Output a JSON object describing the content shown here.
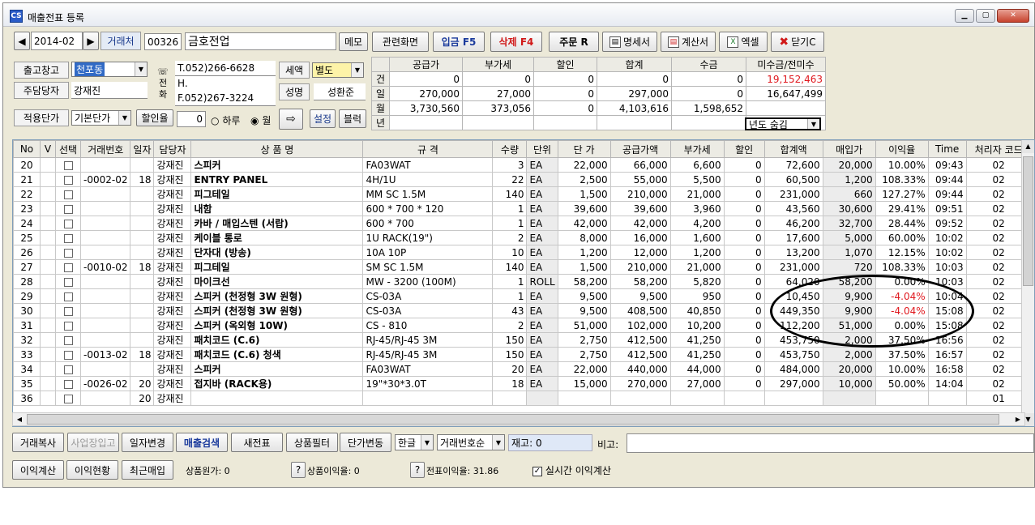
{
  "window": {
    "title": "매출전표 등록"
  },
  "header": {
    "period": "2014-02",
    "customer_label": "거래처",
    "customer_code": "00326",
    "customer_name": "금호전업",
    "memo_label": "메모",
    "warehouse_label": "출고창고",
    "warehouse_value": "천포동",
    "manager_label": "주담당자",
    "manager_value": "강재진",
    "price_label": "적용단가",
    "price_value": "기본단가",
    "discount_label": "할인율",
    "discount_value": "0",
    "radio_day": "하루",
    "radio_month": "월",
    "setting_label": "설정",
    "block_label": "블럭",
    "phone_label": "전화",
    "tel": "T.052)266-6628",
    "hp": "H.",
    "fax": "F.052)267-3224",
    "tax_label": "세액",
    "tax_value": "별도",
    "name_label": "성명",
    "name_value": "성환준"
  },
  "toolbar": {
    "related": "관련화면",
    "deposit": "입금 F5",
    "delete": "삭제 F4",
    "order": "주문 R",
    "statement": "명세서",
    "invoice": "계산서",
    "excel": "엑셀",
    "close": "닫기C"
  },
  "summary": {
    "headers": [
      "공급가",
      "부가세",
      "할인",
      "합계",
      "수금",
      "미수금/전미수"
    ],
    "rows": [
      {
        "label": "건",
        "values": [
          "0",
          "0",
          "0",
          "0",
          "0",
          "19,152,463"
        ]
      },
      {
        "label": "일",
        "values": [
          "270,000",
          "27,000",
          "0",
          "297,000",
          "0",
          "16,647,499"
        ]
      },
      {
        "label": "월",
        "values": [
          "3,730,560",
          "373,056",
          "0",
          "4,103,616",
          "1,598,652",
          ""
        ]
      },
      {
        "label": "년",
        "values": [
          "",
          "",
          "",
          "",
          "",
          ""
        ]
      }
    ],
    "year_select": "년도 숨김"
  },
  "grid": {
    "columns": [
      "No",
      "V",
      "선택",
      "거래번호",
      "일자",
      "담당자",
      "상 품 명",
      "규 격",
      "수량",
      "단위",
      "단 가",
      "공급가액",
      "부가세",
      "할인",
      "합계액",
      "매입가",
      "이익율",
      "Time",
      "처리자 코드"
    ],
    "rows": [
      [
        "20",
        "",
        "",
        "",
        "",
        "강재진",
        "스피커",
        "FA03WAT",
        "3",
        "EA",
        "22,000",
        "66,000",
        "6,600",
        "0",
        "72,600",
        "20,000",
        "10.00%",
        "09:43",
        "02"
      ],
      [
        "21",
        "",
        "",
        "-0002-02",
        "18",
        "강재진",
        "ENTRY PANEL",
        "4H/1U",
        "22",
        "EA",
        "2,500",
        "55,000",
        "5,500",
        "0",
        "60,500",
        "1,200",
        "108.33%",
        "09:44",
        "02"
      ],
      [
        "22",
        "",
        "",
        "",
        "",
        "강재진",
        "피그테일",
        "MM SC 1.5M",
        "140",
        "EA",
        "1,500",
        "210,000",
        "21,000",
        "0",
        "231,000",
        "660",
        "127.27%",
        "09:44",
        "02"
      ],
      [
        "23",
        "",
        "",
        "",
        "",
        "강재진",
        "내함",
        "600 * 700 * 120",
        "1",
        "EA",
        "39,600",
        "39,600",
        "3,960",
        "0",
        "43,560",
        "30,600",
        "29.41%",
        "09:51",
        "02"
      ],
      [
        "24",
        "",
        "",
        "",
        "",
        "강재진",
        "카바 / 매입스텐 (서랍)",
        "600 * 700",
        "1",
        "EA",
        "42,000",
        "42,000",
        "4,200",
        "0",
        "46,200",
        "32,700",
        "28.44%",
        "09:52",
        "02"
      ],
      [
        "25",
        "",
        "",
        "",
        "",
        "강재진",
        "케이블 통로",
        "1U  RACK(19\")",
        "2",
        "EA",
        "8,000",
        "16,000",
        "1,600",
        "0",
        "17,600",
        "5,000",
        "60.00%",
        "10:02",
        "02"
      ],
      [
        "26",
        "",
        "",
        "",
        "",
        "강재진",
        "단자대 (방송)",
        "10A 10P",
        "10",
        "EA",
        "1,200",
        "12,000",
        "1,200",
        "0",
        "13,200",
        "1,070",
        "12.15%",
        "10:02",
        "02"
      ],
      [
        "27",
        "",
        "",
        "-0010-02",
        "18",
        "강재진",
        "피그테일",
        "SM SC 1.5M",
        "140",
        "EA",
        "1,500",
        "210,000",
        "21,000",
        "0",
        "231,000",
        "720",
        "108.33%",
        "10:03",
        "02"
      ],
      [
        "28",
        "",
        "",
        "",
        "",
        "강재진",
        "마이크선",
        "MW - 3200 (100M)",
        "1",
        "ROLL",
        "58,200",
        "58,200",
        "5,820",
        "0",
        "64,020",
        "58,200",
        "0.00%",
        "10:03",
        "02"
      ],
      [
        "29",
        "",
        "",
        "",
        "",
        "강재진",
        "스피커 (천정형 3W 원형)",
        "CS-03A",
        "1",
        "EA",
        "9,500",
        "9,500",
        "950",
        "0",
        "10,450",
        "9,900",
        "-4.04%",
        "10:04",
        "02"
      ],
      [
        "30",
        "",
        "",
        "",
        "",
        "강재진",
        "스피커 (천정형 3W 원형)",
        "CS-03A",
        "43",
        "EA",
        "9,500",
        "408,500",
        "40,850",
        "0",
        "449,350",
        "9,900",
        "-4.04%",
        "15:08",
        "02"
      ],
      [
        "31",
        "",
        "",
        "",
        "",
        "강재진",
        "스피커 (옥외형 10W)",
        "CS - 810",
        "2",
        "EA",
        "51,000",
        "102,000",
        "10,200",
        "0",
        "112,200",
        "51,000",
        "0.00%",
        "15:08",
        "02"
      ],
      [
        "32",
        "",
        "",
        "",
        "",
        "강재진",
        "패치코드 (C.6)",
        "RJ-45/RJ-45   3M",
        "150",
        "EA",
        "2,750",
        "412,500",
        "41,250",
        "0",
        "453,750",
        "2,000",
        "37.50%",
        "16:56",
        "02"
      ],
      [
        "33",
        "",
        "",
        "-0013-02",
        "18",
        "강재진",
        "패치코드 (C.6) 청색",
        "RJ-45/RJ-45   3M",
        "150",
        "EA",
        "2,750",
        "412,500",
        "41,250",
        "0",
        "453,750",
        "2,000",
        "37.50%",
        "16:57",
        "02"
      ],
      [
        "34",
        "",
        "",
        "",
        "",
        "강재진",
        "스피커",
        "FA03WAT",
        "20",
        "EA",
        "22,000",
        "440,000",
        "44,000",
        "0",
        "484,000",
        "20,000",
        "10.00%",
        "16:58",
        "02"
      ],
      [
        "35",
        "",
        "",
        "-0026-02",
        "20",
        "강재진",
        "접지바 (RACK용)",
        "19\"*30*3.0T",
        "18",
        "EA",
        "15,000",
        "270,000",
        "27,000",
        "0",
        "297,000",
        "10,000",
        "50.00%",
        "14:04",
        "02"
      ],
      [
        "36",
        "",
        "",
        "",
        "20",
        "강재진",
        "",
        "",
        "",
        "",
        "",
        "",
        "",
        "",
        "",
        "",
        "",
        "",
        "01"
      ]
    ]
  },
  "bottom1": {
    "copy": "거래복사",
    "bizin": "사업장입고",
    "datechg": "일자변경",
    "salesearch": "매출검색",
    "newslip": "새전표",
    "prodfilter": "상품필터",
    "pricechg": "단가변동",
    "lang": "한글",
    "sort": "거래번호순",
    "stock": "재고: 0",
    "note_label": "비고:"
  },
  "bottom2": {
    "profitcalc": "이익계산",
    "profitstat": "이익현황",
    "recentbuy": "최근매입",
    "cost": "상품원가: 0",
    "q": "?",
    "prodprofit": "상품이익율: 0",
    "slipprofit": "전표이익율: 31.86",
    "realtime": "실시간 이익계산"
  }
}
